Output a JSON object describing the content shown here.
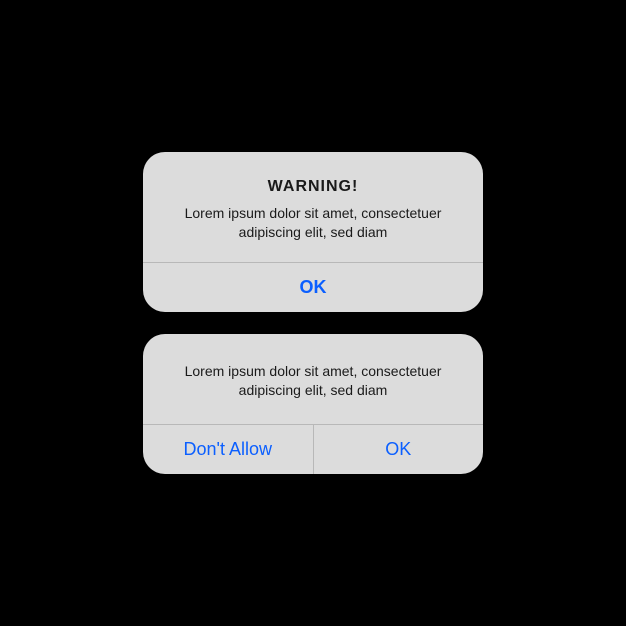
{
  "alerts": {
    "warning": {
      "title": "WARNING!",
      "message": "Lorem ipsum dolor sit amet, consectetuer adipiscing elit, sed diam",
      "ok_label": "OK"
    },
    "permission": {
      "message": "Lorem ipsum dolor sit amet, consectetuer adipiscing elit, sed diam",
      "deny_label": "Don't Allow",
      "ok_label": "OK"
    }
  }
}
